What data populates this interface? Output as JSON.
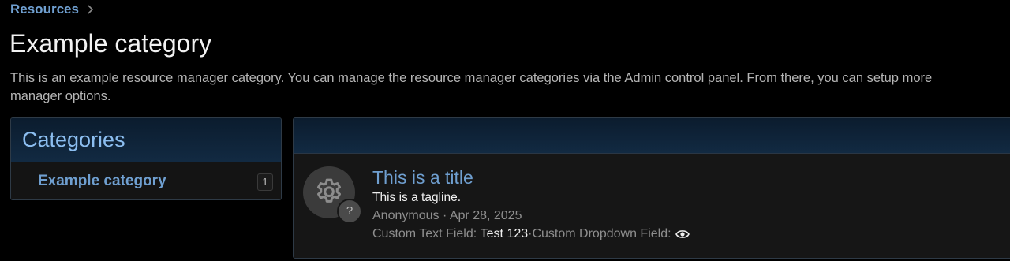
{
  "breadcrumb": {
    "items": [
      "Resources"
    ]
  },
  "page": {
    "title": "Example category",
    "description_line1": "This is an example resource manager category. You can manage the resource manager categories via the Admin control panel. From there, you can setup more",
    "description_line2": "manager options."
  },
  "sidebar": {
    "header": "Categories",
    "items": [
      {
        "label": "Example category",
        "count": "1"
      }
    ]
  },
  "resource": {
    "title": "This is a title",
    "tagline": "This is a tagline.",
    "icon": "gear-icon",
    "badge": "?",
    "author": "Anonymous",
    "meta_sep": " · ",
    "date": "Apr 28, 2025",
    "custom_text_label": "Custom Text Field:",
    "custom_text_value": "Test 123",
    "custom_dropdown_label": "Custom Dropdown Field:",
    "custom_dropdown_icon": "eye-icon"
  },
  "colors": {
    "link": "#6f9fd0",
    "background": "#000000",
    "header_gradient": "#122a42"
  }
}
